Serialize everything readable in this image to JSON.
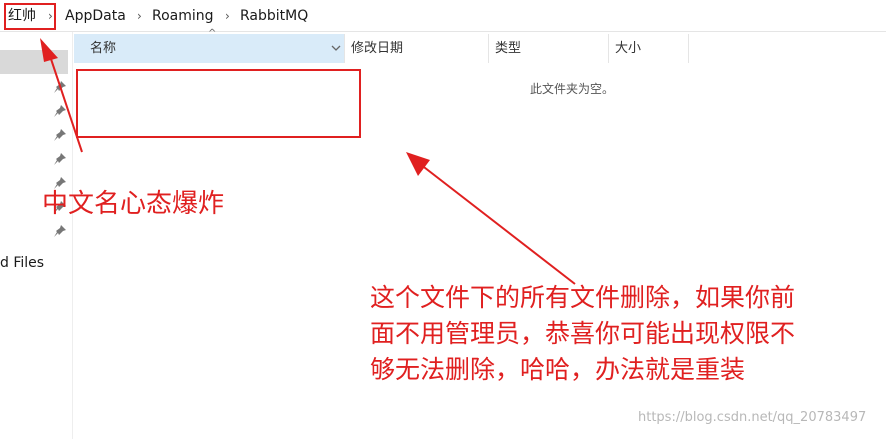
{
  "breadcrumb": {
    "items": [
      "红帅",
      "AppData",
      "Roaming",
      "RabbitMQ"
    ],
    "separator": "›"
  },
  "nav": {
    "partial_item": "d Files",
    "pin_icon": "pin-icon"
  },
  "columns": {
    "name": "名称",
    "date_modified": "修改日期",
    "type": "类型",
    "size": "大小"
  },
  "content": {
    "empty_message": "此文件夹为空。"
  },
  "annotations": {
    "label_1": "中文名心态爆炸",
    "label_2_lines": [
      "这个文件下的所有文件删除，如果你前",
      "面不用管理员，恭喜你可能出现权限不",
      "够无法删除，哈哈，办法就是重装"
    ],
    "color": "#e02020"
  },
  "watermark": "https://blog.csdn.net/qq_20783497"
}
